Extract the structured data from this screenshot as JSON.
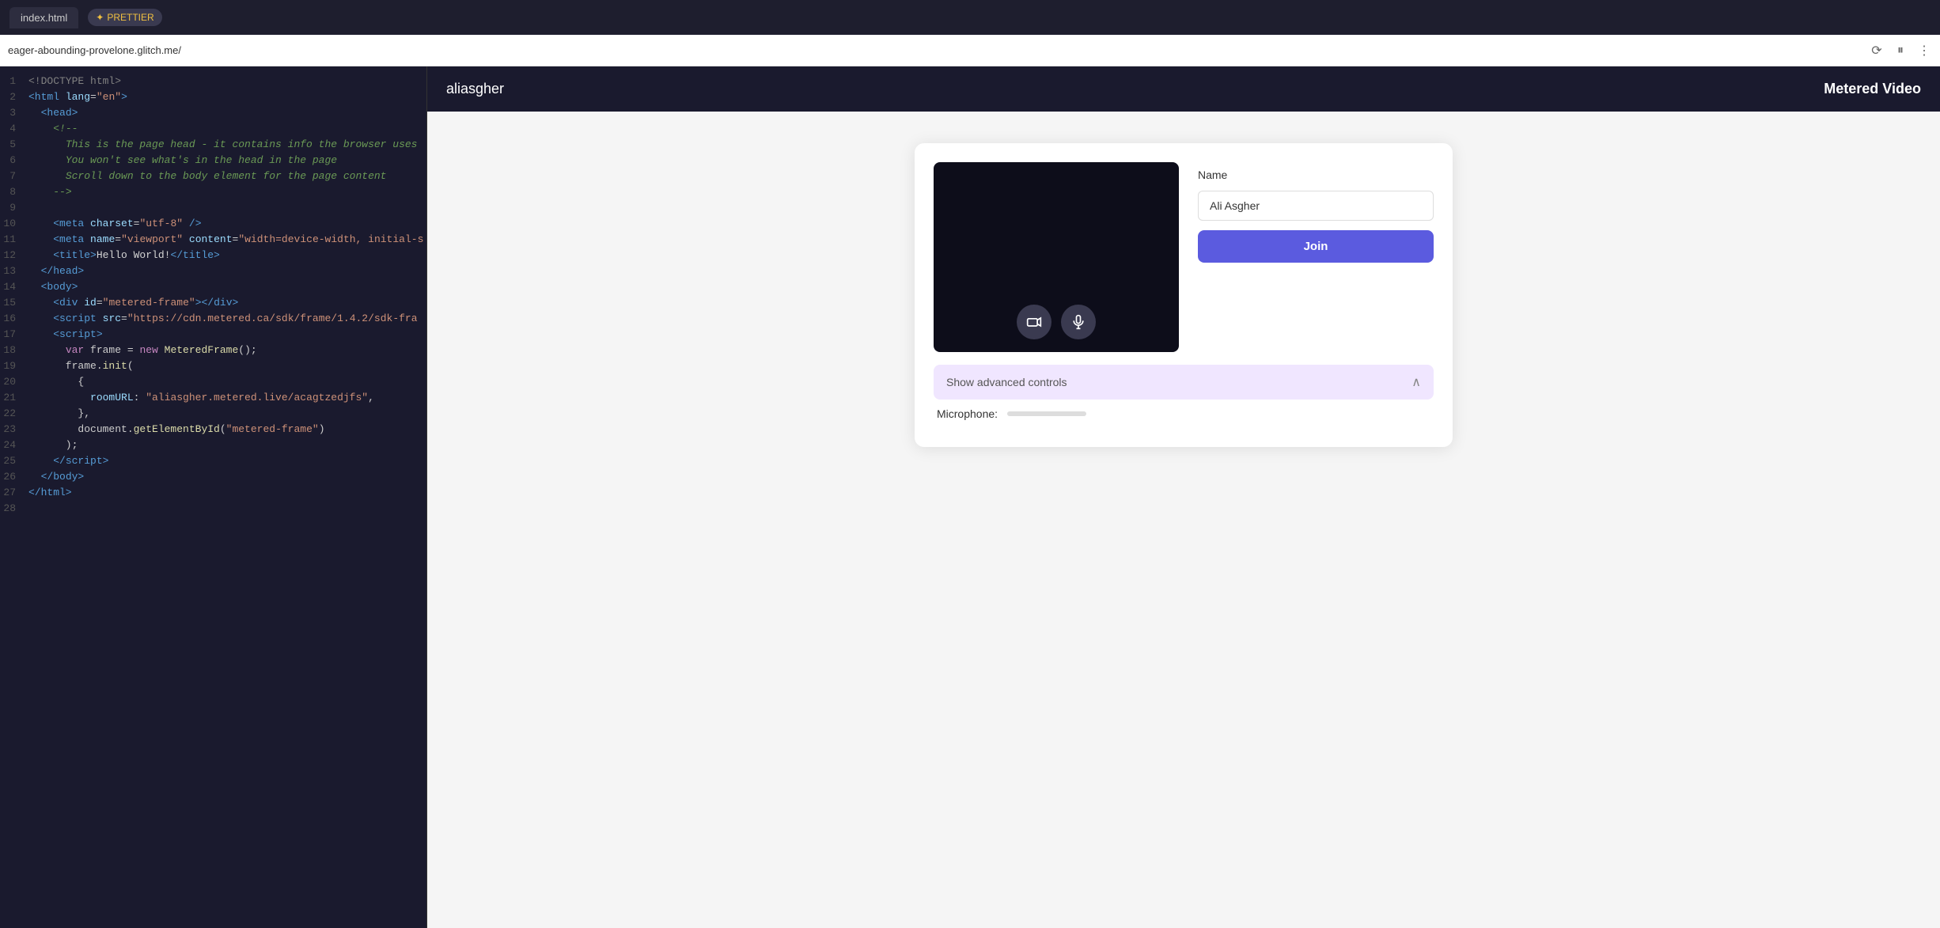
{
  "topbar": {
    "tab_label": "index.html",
    "prettier_icon": "✦",
    "prettier_label": "PRETTIER"
  },
  "urlbar": {
    "url": "eager-abounding-provelone.glitch.me/",
    "refresh_icon": "⟳",
    "pause_icon": "⏸",
    "more_icon": "⋮"
  },
  "code_editor": {
    "lines": [
      {
        "num": 1,
        "html": "<span class='kw-lt'>&lt;!DOCTYPE html&gt;</span>"
      },
      {
        "num": 2,
        "html": "<span class='kw-blue'>&lt;html</span> <span class='attr-name'>lang</span>=<span class='attr-val'>\"en\"</span><span class='kw-blue'>&gt;</span>"
      },
      {
        "num": 3,
        "html": "  <span class='kw-blue'>&lt;head&gt;</span>"
      },
      {
        "num": 4,
        "html": "    <span class='comment'>&lt;!--</span>"
      },
      {
        "num": 5,
        "html": "      <span class='comment'>This is the page head - it contains info the browser uses</span>"
      },
      {
        "num": 6,
        "html": "      <span class='comment'>You won't see what's in the head in the page</span>"
      },
      {
        "num": 7,
        "html": "      <span class='comment'>Scroll down to the body element for the page content</span>"
      },
      {
        "num": 8,
        "html": "    <span class='comment'>--&gt;</span>"
      },
      {
        "num": 9,
        "html": ""
      },
      {
        "num": 10,
        "html": "    <span class='kw-blue'>&lt;meta</span> <span class='attr-name'>charset</span>=<span class='attr-val'>\"utf-8\"</span> <span class='kw-blue'>/&gt;</span>"
      },
      {
        "num": 11,
        "html": "    <span class='kw-blue'>&lt;meta</span> <span class='attr-name'>name</span>=<span class='attr-val'>\"viewport\"</span> <span class='attr-name'>content</span>=<span class='attr-val'>\"width=device-width, initial-s</span>"
      },
      {
        "num": 12,
        "html": "    <span class='kw-blue'>&lt;title&gt;</span><span class='kw-white'>Hello World!</span><span class='kw-blue'>&lt;/title&gt;</span>"
      },
      {
        "num": 13,
        "html": "  <span class='kw-blue'>&lt;/head&gt;</span>"
      },
      {
        "num": 14,
        "html": "  <span class='kw-blue'>&lt;body&gt;</span>"
      },
      {
        "num": 15,
        "html": "    <span class='kw-blue'>&lt;div</span> <span class='attr-name'>id</span>=<span class='attr-val'>\"metered-frame\"</span><span class='kw-blue'>&gt;&lt;/div&gt;</span>"
      },
      {
        "num": 16,
        "html": "    <span class='kw-blue'>&lt;script</span> <span class='attr-name'>src</span>=<span class='attr-val'>\"https://cdn.metered.ca/sdk/frame/1.4.2/sdk-fra</span>"
      },
      {
        "num": 17,
        "html": "    <span class='kw-blue'>&lt;script&gt;</span>"
      },
      {
        "num": 18,
        "html": "      <span class='kw-purple'>var</span> frame = <span class='kw-purple'>new</span> <span class='kw-yellow'>MeteredFrame</span>();"
      },
      {
        "num": 19,
        "html": "      frame.<span class='kw-yellow'>init</span>("
      },
      {
        "num": 20,
        "html": "        {"
      },
      {
        "num": 21,
        "html": "          <span class='attr-name'>roomURL</span>: <span class='attr-val'>\"aliasgher.metered.live/acagtzedjfs\"</span>,"
      },
      {
        "num": 22,
        "html": "        },"
      },
      {
        "num": 23,
        "html": "        document.<span class='kw-yellow'>getElementById</span>(<span class='attr-val'>\"metered-frame\"</span>)"
      },
      {
        "num": 24,
        "html": "      );"
      },
      {
        "num": 25,
        "html": "    <span class='kw-blue'>&lt;/script&gt;</span>"
      },
      {
        "num": 26,
        "html": "  <span class='kw-blue'>&lt;/body&gt;</span>"
      },
      {
        "num": 27,
        "html": "<span class='kw-blue'>&lt;/html&gt;</span>"
      },
      {
        "num": 28,
        "html": ""
      }
    ]
  },
  "app": {
    "brand": "aliasgher",
    "title": "Metered Video",
    "video_bg": "#0d0d1a",
    "camera_icon": "📷",
    "mic_icon": "🎤",
    "name_label": "Name",
    "name_value": "Ali Asgher",
    "join_label": "Join",
    "advanced_label": "Show advanced controls",
    "microphone_label": "Microphone:"
  },
  "colors": {
    "header_bg": "#1a1a2e",
    "join_btn": "#5b5bdf",
    "advanced_bg": "#f0e6ff"
  }
}
